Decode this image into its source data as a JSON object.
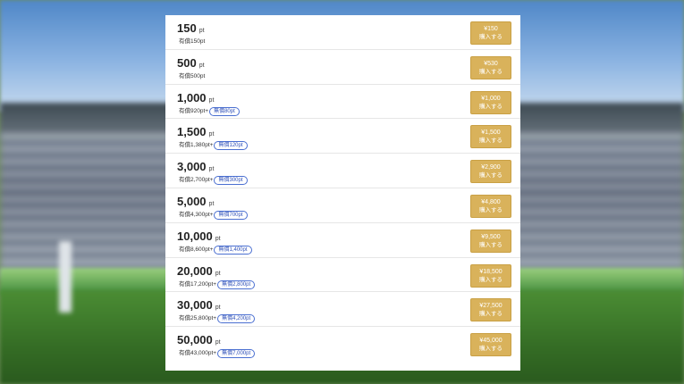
{
  "items": [
    {
      "amount": "150",
      "unit": "pt",
      "paid": "有償150pt",
      "bonus": "",
      "price": "¥150",
      "buy_label": "購入する"
    },
    {
      "amount": "500",
      "unit": "pt",
      "paid": "有償500pt",
      "bonus": "",
      "price": "¥530",
      "buy_label": "購入する"
    },
    {
      "amount": "1,000",
      "unit": "pt",
      "paid": "有償920pt+",
      "bonus": "無償80pt",
      "price": "¥1,000",
      "buy_label": "購入する"
    },
    {
      "amount": "1,500",
      "unit": "pt",
      "paid": "有償1,380pt+",
      "bonus": "無償120pt",
      "price": "¥1,500",
      "buy_label": "購入する"
    },
    {
      "amount": "3,000",
      "unit": "pt",
      "paid": "有償2,700pt+",
      "bonus": "無償300pt",
      "price": "¥2,900",
      "buy_label": "購入する"
    },
    {
      "amount": "5,000",
      "unit": "pt",
      "paid": "有償4,300pt+",
      "bonus": "無償700pt",
      "price": "¥4,800",
      "buy_label": "購入する"
    },
    {
      "amount": "10,000",
      "unit": "pt",
      "paid": "有償8,600pt+",
      "bonus": "無償1,400pt",
      "price": "¥9,500",
      "buy_label": "購入する"
    },
    {
      "amount": "20,000",
      "unit": "pt",
      "paid": "有償17,200pt+",
      "bonus": "無償2,800pt",
      "price": "¥18,500",
      "buy_label": "購入する"
    },
    {
      "amount": "30,000",
      "unit": "pt",
      "paid": "有償25,800pt+",
      "bonus": "無償4,200pt",
      "price": "¥27,500",
      "buy_label": "購入する"
    },
    {
      "amount": "50,000",
      "unit": "pt",
      "paid": "有償43,000pt+",
      "bonus": "無償7,000pt",
      "price": "¥45,000",
      "buy_label": "購入する"
    }
  ]
}
